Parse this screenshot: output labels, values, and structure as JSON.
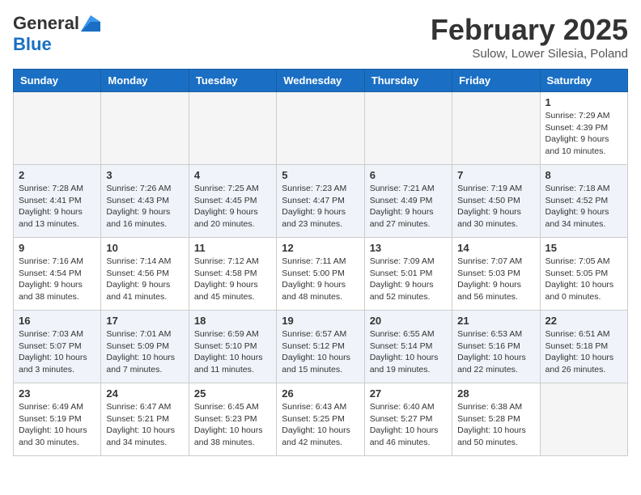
{
  "header": {
    "logo_general": "General",
    "logo_blue": "Blue",
    "month_title": "February 2025",
    "location": "Sulow, Lower Silesia, Poland"
  },
  "weekdays": [
    "Sunday",
    "Monday",
    "Tuesday",
    "Wednesday",
    "Thursday",
    "Friday",
    "Saturday"
  ],
  "weeks": [
    {
      "alt": false,
      "days": [
        {
          "num": "",
          "info": ""
        },
        {
          "num": "",
          "info": ""
        },
        {
          "num": "",
          "info": ""
        },
        {
          "num": "",
          "info": ""
        },
        {
          "num": "",
          "info": ""
        },
        {
          "num": "",
          "info": ""
        },
        {
          "num": "1",
          "info": "Sunrise: 7:29 AM\nSunset: 4:39 PM\nDaylight: 9 hours\nand 10 minutes."
        }
      ]
    },
    {
      "alt": true,
      "days": [
        {
          "num": "2",
          "info": "Sunrise: 7:28 AM\nSunset: 4:41 PM\nDaylight: 9 hours\nand 13 minutes."
        },
        {
          "num": "3",
          "info": "Sunrise: 7:26 AM\nSunset: 4:43 PM\nDaylight: 9 hours\nand 16 minutes."
        },
        {
          "num": "4",
          "info": "Sunrise: 7:25 AM\nSunset: 4:45 PM\nDaylight: 9 hours\nand 20 minutes."
        },
        {
          "num": "5",
          "info": "Sunrise: 7:23 AM\nSunset: 4:47 PM\nDaylight: 9 hours\nand 23 minutes."
        },
        {
          "num": "6",
          "info": "Sunrise: 7:21 AM\nSunset: 4:49 PM\nDaylight: 9 hours\nand 27 minutes."
        },
        {
          "num": "7",
          "info": "Sunrise: 7:19 AM\nSunset: 4:50 PM\nDaylight: 9 hours\nand 30 minutes."
        },
        {
          "num": "8",
          "info": "Sunrise: 7:18 AM\nSunset: 4:52 PM\nDaylight: 9 hours\nand 34 minutes."
        }
      ]
    },
    {
      "alt": false,
      "days": [
        {
          "num": "9",
          "info": "Sunrise: 7:16 AM\nSunset: 4:54 PM\nDaylight: 9 hours\nand 38 minutes."
        },
        {
          "num": "10",
          "info": "Sunrise: 7:14 AM\nSunset: 4:56 PM\nDaylight: 9 hours\nand 41 minutes."
        },
        {
          "num": "11",
          "info": "Sunrise: 7:12 AM\nSunset: 4:58 PM\nDaylight: 9 hours\nand 45 minutes."
        },
        {
          "num": "12",
          "info": "Sunrise: 7:11 AM\nSunset: 5:00 PM\nDaylight: 9 hours\nand 48 minutes."
        },
        {
          "num": "13",
          "info": "Sunrise: 7:09 AM\nSunset: 5:01 PM\nDaylight: 9 hours\nand 52 minutes."
        },
        {
          "num": "14",
          "info": "Sunrise: 7:07 AM\nSunset: 5:03 PM\nDaylight: 9 hours\nand 56 minutes."
        },
        {
          "num": "15",
          "info": "Sunrise: 7:05 AM\nSunset: 5:05 PM\nDaylight: 10 hours\nand 0 minutes."
        }
      ]
    },
    {
      "alt": true,
      "days": [
        {
          "num": "16",
          "info": "Sunrise: 7:03 AM\nSunset: 5:07 PM\nDaylight: 10 hours\nand 3 minutes."
        },
        {
          "num": "17",
          "info": "Sunrise: 7:01 AM\nSunset: 5:09 PM\nDaylight: 10 hours\nand 7 minutes."
        },
        {
          "num": "18",
          "info": "Sunrise: 6:59 AM\nSunset: 5:10 PM\nDaylight: 10 hours\nand 11 minutes."
        },
        {
          "num": "19",
          "info": "Sunrise: 6:57 AM\nSunset: 5:12 PM\nDaylight: 10 hours\nand 15 minutes."
        },
        {
          "num": "20",
          "info": "Sunrise: 6:55 AM\nSunset: 5:14 PM\nDaylight: 10 hours\nand 19 minutes."
        },
        {
          "num": "21",
          "info": "Sunrise: 6:53 AM\nSunset: 5:16 PM\nDaylight: 10 hours\nand 22 minutes."
        },
        {
          "num": "22",
          "info": "Sunrise: 6:51 AM\nSunset: 5:18 PM\nDaylight: 10 hours\nand 26 minutes."
        }
      ]
    },
    {
      "alt": false,
      "days": [
        {
          "num": "23",
          "info": "Sunrise: 6:49 AM\nSunset: 5:19 PM\nDaylight: 10 hours\nand 30 minutes."
        },
        {
          "num": "24",
          "info": "Sunrise: 6:47 AM\nSunset: 5:21 PM\nDaylight: 10 hours\nand 34 minutes."
        },
        {
          "num": "25",
          "info": "Sunrise: 6:45 AM\nSunset: 5:23 PM\nDaylight: 10 hours\nand 38 minutes."
        },
        {
          "num": "26",
          "info": "Sunrise: 6:43 AM\nSunset: 5:25 PM\nDaylight: 10 hours\nand 42 minutes."
        },
        {
          "num": "27",
          "info": "Sunrise: 6:40 AM\nSunset: 5:27 PM\nDaylight: 10 hours\nand 46 minutes."
        },
        {
          "num": "28",
          "info": "Sunrise: 6:38 AM\nSunset: 5:28 PM\nDaylight: 10 hours\nand 50 minutes."
        },
        {
          "num": "",
          "info": ""
        }
      ]
    }
  ]
}
